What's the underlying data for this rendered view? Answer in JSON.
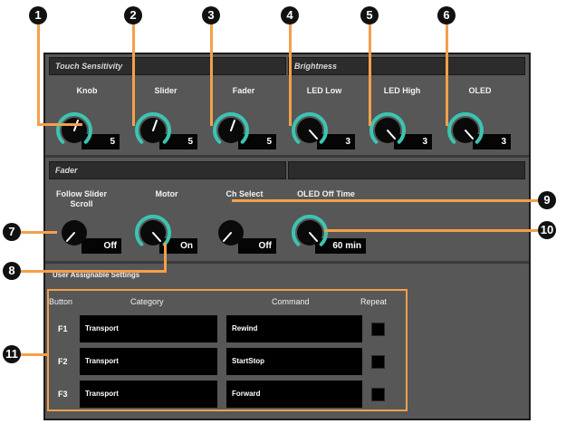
{
  "callouts": [
    "1",
    "2",
    "3",
    "4",
    "5",
    "6",
    "7",
    "8",
    "9",
    "10",
    "11"
  ],
  "sections": {
    "touch": "Touch Sensitivity",
    "brightness": "Brightness",
    "fader": "Fader",
    "user": "User Assignable Settings"
  },
  "touch": [
    {
      "label": "Knob",
      "value": "5"
    },
    {
      "label": "Slider",
      "value": "5"
    },
    {
      "label": "Fader",
      "value": "5"
    }
  ],
  "brightness": [
    {
      "label": "LED Low",
      "value": "3"
    },
    {
      "label": "LED High",
      "value": "3"
    },
    {
      "label": "OLED",
      "value": "3"
    }
  ],
  "fader": [
    {
      "label": "Follow Slider Scroll",
      "value": "Off"
    },
    {
      "label": "Motor",
      "value": "On"
    },
    {
      "label": "Ch Select",
      "value": "Off"
    },
    {
      "label": "OLED Off Time",
      "value": "60 min"
    }
  ],
  "table": {
    "headers": {
      "button": "Button",
      "category": "Category",
      "command": "Command",
      "repeat": "Repeat"
    },
    "rows": [
      {
        "button": "F1",
        "category": "Transport",
        "command": "Rewind"
      },
      {
        "button": "F2",
        "category": "Transport",
        "command": "StartStop"
      },
      {
        "button": "F3",
        "category": "Transport",
        "command": "Forward"
      }
    ]
  },
  "colors": {
    "accent": "#3cc4b1",
    "callout_line": "#f3a04a"
  }
}
